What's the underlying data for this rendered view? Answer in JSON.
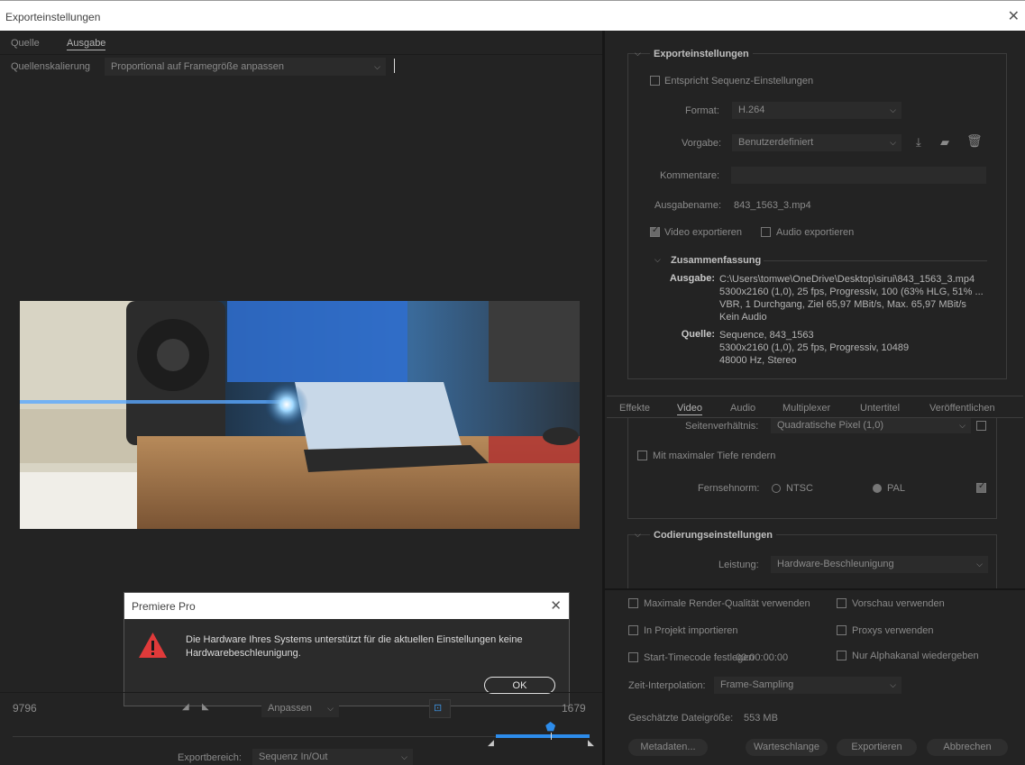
{
  "window": {
    "title": "Exporteinstellungen"
  },
  "left": {
    "tabs": [
      "Quelle",
      "Ausgabe"
    ],
    "scaling_label": "Quellenskalierung",
    "scaling_value": "Proportional auf Framegröße anpassen",
    "timecode_left": "9796",
    "timecode_right": "1679",
    "fit_value": "Anpassen",
    "range_label": "Exportbereich:",
    "range_value": "Sequenz In/Out"
  },
  "dialog": {
    "title": "Premiere Pro",
    "message": "Die Hardware Ihres Systems unterstützt für die aktuellen Einstellungen keine Hardwarebeschleunigung.",
    "ok_label": "OK"
  },
  "export_settings": {
    "header": "Exporteinstellungen",
    "match_sequence": "Entspricht Sequenz-Einstellungen",
    "format_label": "Format:",
    "format_value": "H.264",
    "preset_label": "Vorgabe:",
    "preset_value": "Benutzerdefiniert",
    "comments_label": "Kommentare:",
    "output_name_label": "Ausgabename:",
    "output_name_value": "843_1563_3.mp4",
    "export_video": "Video exportieren",
    "export_audio": "Audio exportieren",
    "summary_header": "Zusammenfassung",
    "summary_output_label": "Ausgabe:",
    "summary_output_lines": [
      "C:\\Users\\tomwe\\OneDrive\\Desktop\\sirui\\843_1563_3.mp4",
      "5300x2160 (1,0), 25 fps, Progressiv, 100 (63% HLG, 51% ...",
      "VBR, 1 Durchgang, Ziel 65,97 MBit/s, Max. 65,97 MBit/s",
      "Kein Audio"
    ],
    "summary_source_label": "Quelle:",
    "summary_source_lines": [
      "Sequence, 843_1563",
      "5300x2160 (1,0), 25 fps, Progressiv, 10489",
      "48000 Hz, Stereo"
    ]
  },
  "settings_tabs": [
    "Effekte",
    "Video",
    "Audio",
    "Multiplexer",
    "Untertitel",
    "Veröffentlichen"
  ],
  "video": {
    "aspect_label": "Seitenverhältnis:",
    "aspect_value": "Quadratische Pixel (1,0)",
    "max_depth": "Mit maximaler Tiefe rendern",
    "tv_standard_label": "Fernsehnorm:",
    "ntsc": "NTSC",
    "pal": "PAL"
  },
  "encoding": {
    "header": "Codierungseinstellungen",
    "performance_label": "Leistung:",
    "performance_value": "Hardware-Beschleunigung"
  },
  "options": {
    "max_render_quality": "Maximale Render-Qualität verwenden",
    "use_previews": "Vorschau verwenden",
    "import_into_project": "In Projekt importieren",
    "use_proxies": "Proxys verwenden",
    "set_start_timecode": "Start-Timecode festlegen",
    "start_timecode_value": "00:00:00:00",
    "alpha_only": "Nur Alphakanal wiedergeben",
    "time_interp_label": "Zeit-Interpolation:",
    "time_interp_value": "Frame-Sampling",
    "est_size_label": "Geschätzte Dateigröße:",
    "est_size_value": "553 MB"
  },
  "buttons": {
    "metadata": "Metadaten...",
    "queue": "Warteschlange",
    "export": "Exportieren",
    "cancel": "Abbrechen"
  },
  "colors": {
    "warning_red": "#e03a3a",
    "accent_blue": "#2d8ceb",
    "background": "#232323"
  }
}
